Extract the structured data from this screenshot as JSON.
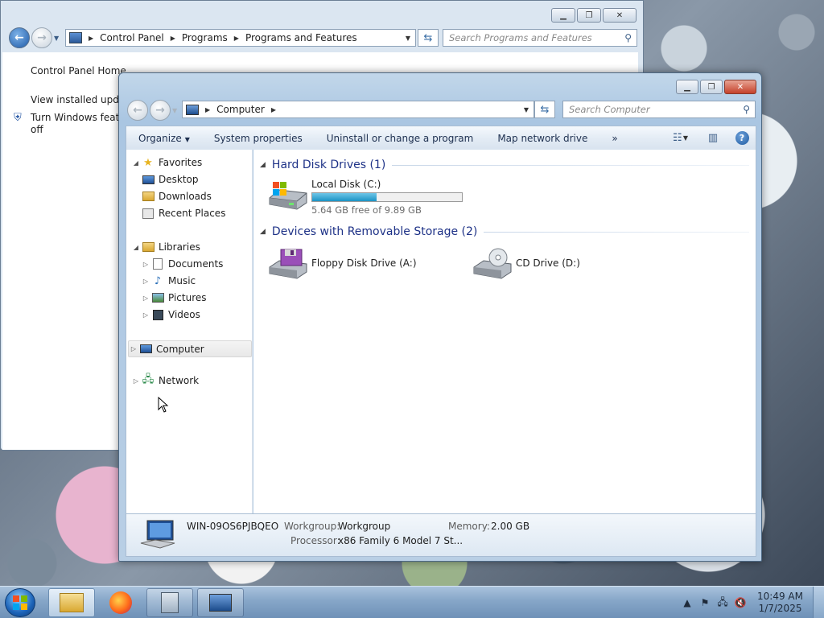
{
  "back_window": {
    "breadcrumb": [
      "Control Panel",
      "Programs",
      "Programs and Features"
    ],
    "search_placeholder": "Search Programs and Features",
    "left_links": [
      "Control Panel Home",
      "View installed update",
      "Turn Windows featu",
      "off"
    ]
  },
  "front_window": {
    "address": [
      "Computer"
    ],
    "search_placeholder": "Search Computer",
    "toolbar": {
      "organize": "Organize",
      "system_properties": "System properties",
      "uninstall": "Uninstall or change a program",
      "map_drive": "Map network drive",
      "more": "»"
    },
    "nav": {
      "favorites": "Favorites",
      "desktop": "Desktop",
      "downloads": "Downloads",
      "recent": "Recent Places",
      "libraries": "Libraries",
      "documents": "Documents",
      "music": "Music",
      "pictures": "Pictures",
      "videos": "Videos",
      "computer": "Computer",
      "network": "Network"
    },
    "groups": {
      "hdd": "Hard Disk Drives (1)",
      "removable": "Devices with Removable Storage (2)"
    },
    "drives": {
      "local": {
        "label": "Local Disk (C:)",
        "free_text": "5.64 GB free of 9.89 GB",
        "used_fraction": 0.43
      },
      "floppy": {
        "label": "Floppy Disk Drive (A:)"
      },
      "cd": {
        "label": "CD Drive (D:)"
      }
    },
    "details": {
      "computer_name": "WIN-09OS6PJBQEO",
      "workgroup_label": "Workgroup:",
      "workgroup_value": "Workgroup",
      "memory_label": "Memory:",
      "memory_value": "2.00 GB",
      "processor_label": "Processor:",
      "processor_value": "x86 Family 6 Model 7 St..."
    }
  },
  "taskbar": {
    "time": "10:49 AM",
    "date": "1/7/2025"
  },
  "colors": {
    "titlebar": "#aac6e2",
    "group_header": "#1e3287",
    "usage_fill": "#1c93c4",
    "close_button": "#c4412a"
  }
}
